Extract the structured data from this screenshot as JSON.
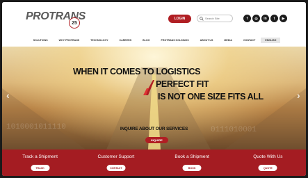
{
  "header": {
    "logo_text": "PROTRANS",
    "logo_badge": "25",
    "login_label": "LOGIN",
    "search_placeholder": "Search Site",
    "social": [
      {
        "icon": "facebook-icon",
        "glyph": "f"
      },
      {
        "icon": "instagram-icon",
        "glyph": "◎"
      },
      {
        "icon": "linkedin-icon",
        "glyph": "in"
      },
      {
        "icon": "twitter-icon",
        "glyph": "t"
      },
      {
        "icon": "youtube-icon",
        "glyph": "▶"
      }
    ]
  },
  "nav": {
    "items": [
      "SOLUTIONS",
      "WHY PROTRANS",
      "TECHNOLOGY",
      "CAREERS",
      "BLOG",
      "PROTRANS HOLDINGS",
      "ABOUT US",
      "MEDIA",
      "CONTACT",
      "ENGLISH"
    ]
  },
  "hero": {
    "line1": "WHEN IT COMES TO LOGISTICS",
    "line2": "PERFECT FIT",
    "line3": "IS NOT ONE SIZE FITS ALL",
    "inquire_title": "INQUIRE ABOUT OUR SERVICES",
    "inquire_button": "INQUIRE"
  },
  "cta_bar": [
    {
      "title": "Track a Shipment",
      "button": "TRACK"
    },
    {
      "title": "Customer Support",
      "button": "CONTACT"
    },
    {
      "title": "Book a Shipment",
      "button": "BOOK"
    },
    {
      "title": "Quote With Us",
      "button": "QUOTE"
    }
  ],
  "colors": {
    "brand_red": "#b01e23",
    "cta_red": "#a41c22"
  }
}
